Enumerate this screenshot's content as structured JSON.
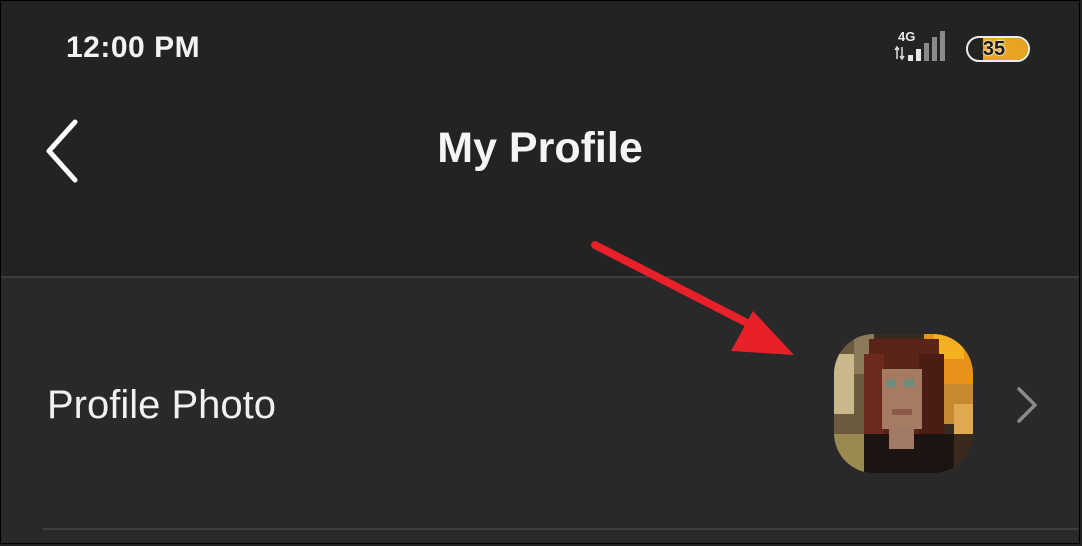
{
  "status_bar": {
    "time": "12:00 PM",
    "network_type": "4G",
    "battery_level": "35",
    "battery_fraction": 0.35,
    "battery_color": "#e6a421"
  },
  "header": {
    "title": "My Profile",
    "back_icon": "chevron-left-icon"
  },
  "rows": [
    {
      "label": "Profile Photo",
      "trailing_icon": "chevron-right-icon",
      "has_avatar": true
    }
  ],
  "annotation": {
    "type": "arrow",
    "color": "#e8202a",
    "points_to": "avatar"
  }
}
